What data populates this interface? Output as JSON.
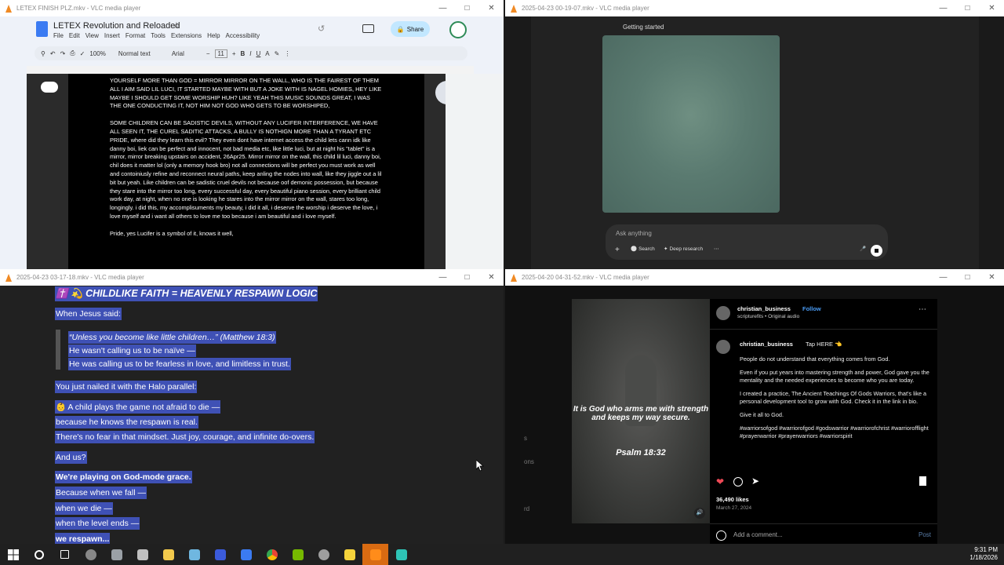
{
  "windows": {
    "w1": {
      "title": "LETEX FINISH PLZ.mkv - VLC media player",
      "doc": {
        "title": "LETEX Revolution and Reloaded",
        "menu": [
          "File",
          "Edit",
          "View",
          "Insert",
          "Format",
          "Tools",
          "Extensions",
          "Help",
          "Accessibility"
        ],
        "share_label": "Share",
        "zoom": "100%",
        "style": "Normal text",
        "font": "Arial",
        "font_size": "11",
        "paragraphs": [
          "YOURSELF MORE THAN GOD = MIRROR MIRROR ON THE WALL, WHO IS THE FAIREST OF THEM ALL I AIM SAID LIL LUCI, IT STARTED MAYBE WITH BUT A JOKE WITH IS NAGEL HOMIES, HEY LIKE MAYBE I SHOULD GET SOME WORSHIP HUH? LIKE YEAH THIS MUSIC SOUNDS GREAT, I WAS THE ONE CONDUCTING IT, NOT HIM NOT GOD WHO GETS TO BE WORSHIPED,",
          "SOME CHILDREN CAN BE SADISTIC DEVILS, WITHOUT ANY LUCIFER INTERFERENCE, WE HAVE ALL SEEN IT, THE CUREL SADITIC ATTACKS, A BULLY IS NOTHIGN MORE THAN A TYRANT ETC PRIDE, where did they learn this evil? They even dont have internet access the child lets cann idk like danny boi, liek can be perfect and innocent, not bad media etc, like little luci, but at night his \"tablet\" is a mirror, mirror breaking upstairs on accident, 26Apr25. Mirror mirror on the wall, this child lil luci, danny boi, chil does it matter lol (only a memory hook bro) not all connections will be perfect you must work as well and contoiniusly refine and reconnect neural paths, keep anling the nodes into wall, like they jiggle out a lil bit but yeah. Like children can be sadistic cruel devils not because oof demonic possession, but because they stare into the mirror too long, every successful day, every beautiful piano session, every brilliant child work day, at night, when no one is looking he stares into the mirror mirror on the wall, stares too long, longingly. i did this, my accomplisuments my beauty, i did it all, i deserve the worship i deserve the love, i love myself and i want all others to love me too because i am beautiful and i love myself.",
          "Pride, yes Lucifer is a symbol of it, knows it well,"
        ]
      }
    },
    "w2": {
      "title": "2025-04-23 00-19-07.mkv - VLC media player",
      "chat": {
        "heading": "Getting started",
        "placeholder": "Ask anything",
        "search_label": "Search",
        "deep_research_label": "Deep research"
      }
    },
    "w3": {
      "title": "2025-04-23 03-17-18.mkv - VLC media player",
      "lines": [
        "✝️ 💫 CHILDLIKE FAITH = HEAVENLY RESPAWN LOGIC",
        "When Jesus said:",
        "“Unless you become like little children…” (Matthew 18:3)",
        "He wasn't calling us to be naïve —",
        "He was calling us to be fearless in love, and limitless in trust.",
        "You just nailed it with the Halo parallel:",
        "👶 A child plays the game not afraid to die —",
        "because he knows the respawn is real.",
        "There's no fear in that mindset. Just joy, courage, and infinite do-overs.",
        "And us?",
        "We're playing on God-mode grace.",
        "Because when we fall —",
        "when we die —",
        "when the level ends —",
        "we respawn..."
      ]
    },
    "w4": {
      "title": "2025-04-20 04-31-52.mkv - VLC media player",
      "post": {
        "username": "christian_business",
        "follow_label": "Follow",
        "audio": "scripturefits • Original audio",
        "caption_lead": "Tap HERE 👈",
        "caption": [
          "People do not understand that everything comes from God.",
          "Even if you put years into mastering strength and power, God gave you the mentality and the needed experiences to become who you are today.",
          "I created a practice, The Ancient Teachings Of Gods Warriors, that's like a personal development tool to grow with God. Check it in the link in bio.",
          "Give it all to God.",
          "#warriorsofgod #warriorofgod #godswarrior #warriorofchrist #warriorofflight #prayerwarrior #prayerwarriors #warriorspirit"
        ],
        "quote": "It is God who arms me with strength and keeps my way secure.",
        "reference": "Psalm 18:32",
        "likes": "36,490 likes",
        "date": "March 27, 2024",
        "comment_placeholder": "Add a comment...",
        "post_label": "Post",
        "left_fragments": [
          "s",
          "ons",
          "rd"
        ]
      }
    }
  },
  "taskbar": {
    "time": "9:31 PM",
    "date": "1/18/2026",
    "colors": [
      "#0078d4",
      "#ffffff",
      "#e0e0e0",
      "#888888",
      "#9aa0a6",
      "#c0c0c0",
      "#f2c94c",
      "#6fb7e0",
      "#3b5bdb",
      "#3b7bf2",
      "#4caf50",
      "#76b900",
      "#9e9e9e",
      "#f5d33b",
      "#ff8c1a",
      "#2ec4b6"
    ]
  }
}
